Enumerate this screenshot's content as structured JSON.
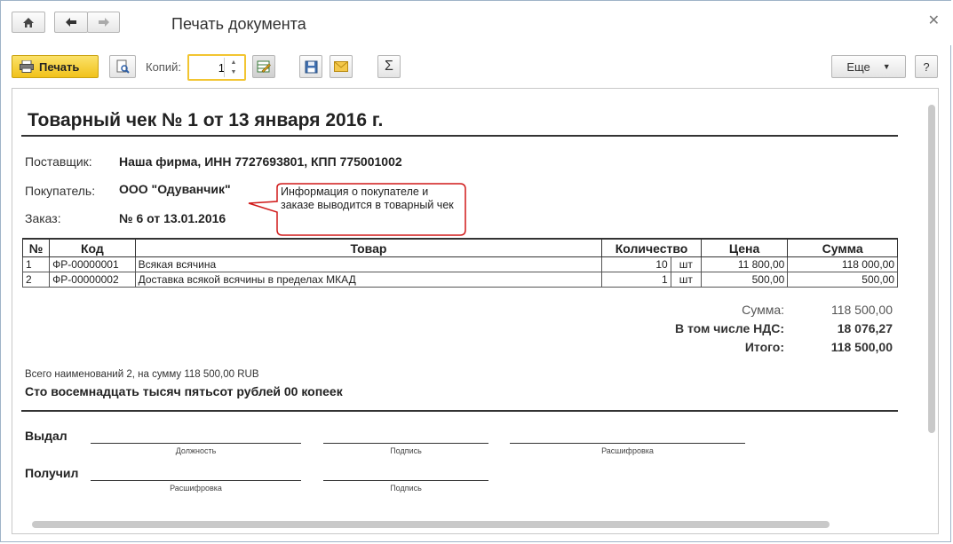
{
  "window": {
    "title": "Печать документа"
  },
  "toolbar": {
    "print_label": "Печать",
    "copies_label": "Копий:",
    "copies_value": "1",
    "more_label": "Еще",
    "help_label": "?",
    "sum_label": "Σ"
  },
  "document": {
    "title": "Товарный чек № 1 от 13 января 2016 г.",
    "supplier_label": "Поставщик:",
    "supplier_value": "Наша фирма,  ИНН 7727693801,  КПП 775001002",
    "buyer_label": "Покупатель:",
    "buyer_value": "ООО \"Одуванчик\"",
    "order_label": "Заказ:",
    "order_value": "№ 6 от 13.01.2016",
    "callout": "Информация о покупателе и заказе выводится в товарный чек",
    "table": {
      "headers": [
        "№",
        "Код",
        "Товар",
        "Количество",
        "Цена",
        "Сумма"
      ],
      "rows": [
        {
          "num": "1",
          "code": "ФР-00000001",
          "item": "Всякая всячина",
          "qty": "10",
          "unit": "шт",
          "price": "11 800,00",
          "sum": "118 000,00"
        },
        {
          "num": "2",
          "code": "ФР-00000002",
          "item": "Доставка всякой всячины в пределах МКАД",
          "qty": "1",
          "unit": "шт",
          "price": "500,00",
          "sum": "500,00"
        }
      ]
    },
    "totals": {
      "sum_label": "Сумма:",
      "sum_value": "118 500,00",
      "vat_label": "В том числе НДС:",
      "vat_value": "18 076,27",
      "total_label": "Итого:",
      "total_value": "118 500,00"
    },
    "summary_line": "Всего наименований 2, на сумму 118 500,00 RUB",
    "amount_words": "Сто восемнадцать тысяч пятьсот рублей 00 копеек",
    "signatures": {
      "issued_label": "Выдал",
      "position_caption": "Должность",
      "signature_caption": "Подпись",
      "decoding_caption": "Расшифровка",
      "received_label": "Получил",
      "received_decoding_caption": "Расшифровка",
      "received_signature_caption": "Подпись"
    }
  },
  "colors": {
    "print_button": "#f1c21b",
    "copies_focus": "#f2c531",
    "callout_border": "#d01818"
  }
}
